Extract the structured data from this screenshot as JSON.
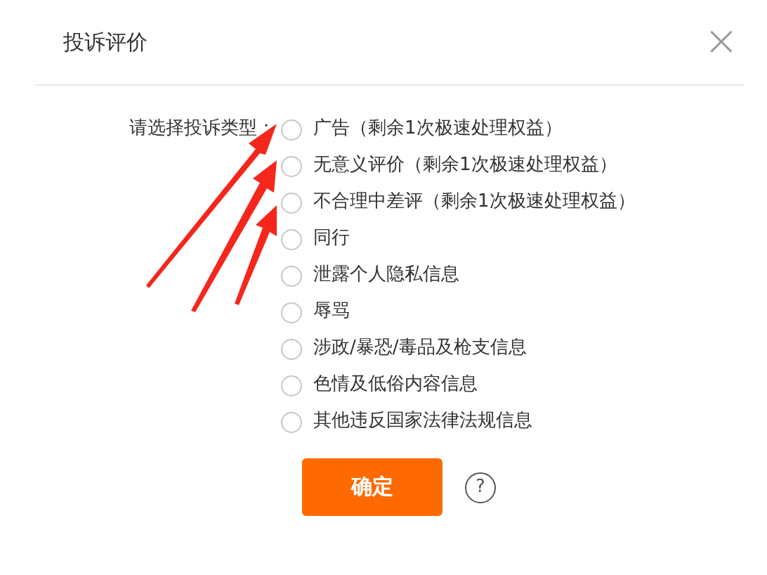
{
  "dialog": {
    "title": "投诉评价",
    "close": "×"
  },
  "form": {
    "label": "请选择投诉类型：",
    "options": [
      {
        "label": "广告（剩余1次极速处理权益）",
        "selected": false
      },
      {
        "label": "无意义评价（剩余1次极速处理权益）",
        "selected": false
      },
      {
        "label": "不合理中差评（剩余1次极速处理权益）",
        "selected": false
      },
      {
        "label": "同行",
        "selected": false
      },
      {
        "label": "泄露个人隐私信息",
        "selected": false
      },
      {
        "label": "辱骂",
        "selected": false
      },
      {
        "label": "涉政/暴恐/毒品及枪支信息",
        "selected": false
      },
      {
        "label": "色情及低俗内容信息",
        "selected": false
      },
      {
        "label": "其他违反国家法律法规信息",
        "selected": false
      }
    ]
  },
  "confirm_button": "确定",
  "help": "?"
}
